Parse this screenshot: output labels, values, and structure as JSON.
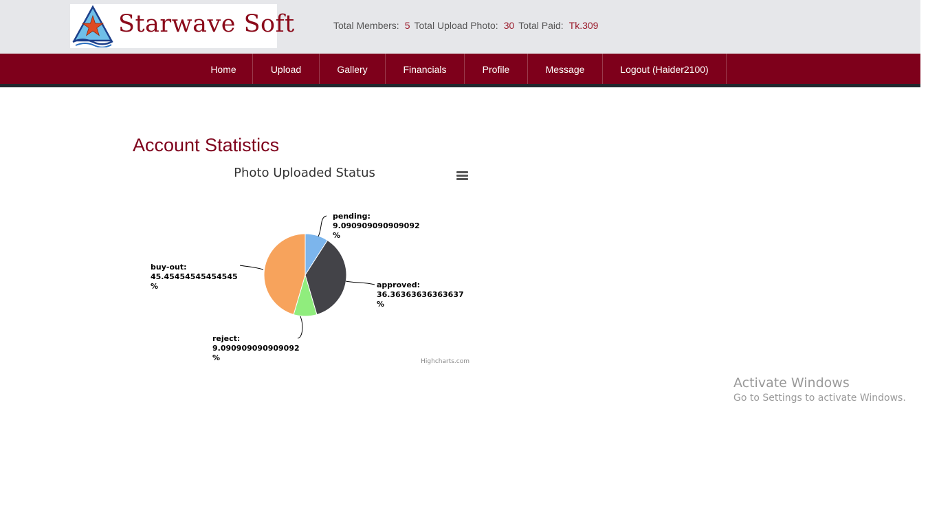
{
  "brand": {
    "name": "Starwave Soft"
  },
  "header_stats": {
    "members_label": "Total Members:",
    "members_value": "5",
    "uploads_label": "Total Upload Photo:",
    "uploads_value": "30",
    "paid_label": "Total Paid:",
    "paid_value": "Tk.309"
  },
  "nav": {
    "items": [
      "Home",
      "Upload",
      "Gallery",
      "Financials",
      "Profile",
      "Message",
      "Logout (Haider2100)"
    ]
  },
  "page": {
    "title": "Account Statistics"
  },
  "chart_data": {
    "type": "pie",
    "title": "Photo Uploaded Status",
    "credit": "Highcharts.com",
    "series": [
      {
        "name": "pending",
        "value": 9.090909090909092,
        "color": "#7cb5ec",
        "label_lines": [
          "pending:",
          "9.090909090909092",
          "%"
        ]
      },
      {
        "name": "approved",
        "value": 36.36363636363637,
        "color": "#434348",
        "label_lines": [
          "approved:",
          "36.36363636363637",
          "%"
        ]
      },
      {
        "name": "reject",
        "value": 9.090909090909092,
        "color": "#90ed7d",
        "label_lines": [
          "reject:",
          "9.090909090909092",
          "%"
        ]
      },
      {
        "name": "buy-out",
        "value": 45.45454545454545,
        "color": "#f7a35c",
        "label_lines": [
          "buy-out:",
          "45.45454545454545",
          "%"
        ]
      }
    ]
  },
  "watermark": {
    "line1": "Activate Windows",
    "line2": "Go to Settings to activate Windows."
  }
}
